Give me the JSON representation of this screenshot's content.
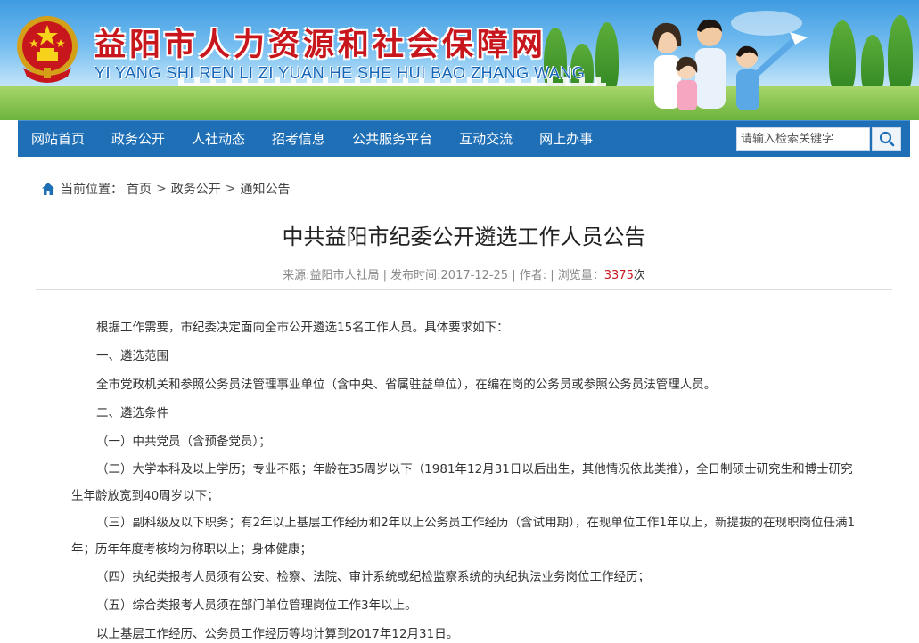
{
  "header": {
    "title": "益阳市人力资源和社会保障网",
    "pinyin": "YI YANG SHI REN LI ZI YUAN HE SHE HUI BAO ZHANG WANG",
    "emblem_icon": "national-emblem-icon"
  },
  "nav": {
    "items": [
      {
        "label": "网站首页"
      },
      {
        "label": "政务公开"
      },
      {
        "label": "人社动态"
      },
      {
        "label": "招考信息"
      },
      {
        "label": "公共服务平台"
      },
      {
        "label": "互动交流"
      },
      {
        "label": "网上办事"
      }
    ],
    "search_placeholder": "请输入检索关键字",
    "search_icon": "search-icon"
  },
  "breadcrumb": {
    "prefix": "当前位置：",
    "items": [
      "首页",
      "政务公开",
      "通知公告"
    ],
    "separator": ">"
  },
  "article": {
    "title": "中共益阳市纪委公开遴选工作人员公告",
    "meta_source": "来源:益阳市人社局 | 发布时间:2017-12-25 | 作者: | 浏览量：",
    "meta_views": "3375",
    "meta_views_unit": "次",
    "paragraphs": [
      "根据工作需要，市纪委决定面向全市公开遴选15名工作人员。具体要求如下：",
      "一、遴选范围",
      "全市党政机关和参照公务员法管理事业单位（含中央、省属驻益单位），在编在岗的公务员或参照公务员法管理人员。",
      "二、遴选条件",
      "（一）中共党员（含预备党员）；",
      "（二）大学本科及以上学历；专业不限；年龄在35周岁以下（1981年12月31日以后出生，其他情况依此类推），全日制硕士研究生和博士研究生年龄放宽到40周岁以下；",
      "（三）副科级及以下职务；有2年以上基层工作经历和2年以上公务员工作经历（含试用期），在现单位工作1年以上，新提拔的在现职岗位任满1年；历年年度考核均为称职以上；身体健康；",
      "（四）执纪类报考人员须有公安、检察、法院、审计系统或纪检监察系统的执纪执法业务岗位工作经历；",
      "（五）综合类报考人员须在部门单位管理岗位工作3年以上。",
      "以上基层工作经历、公务员工作经历等均计算到2017年12月31日。"
    ]
  },
  "colors": {
    "nav_bg": "#1e6fb6",
    "title_red": "#c8161d",
    "pinyin_blue": "#1565b8"
  }
}
